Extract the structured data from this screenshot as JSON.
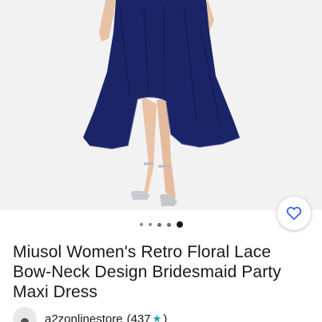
{
  "listing": {
    "title": "Miusol Women's Retro Floral Lace Bow-Neck Design Bridesmaid Party Maxi Dress",
    "image_carousel": {
      "count": 5,
      "active_index": 4
    }
  },
  "seller": {
    "name": "a2zonlinestore",
    "feedback_count_text": "(437",
    "feedback_close": ")",
    "star_icon": "star-icon"
  },
  "actions": {
    "favorite_icon": "heart-outline-icon"
  },
  "colors": {
    "accent_blue": "#3665f3",
    "dress_navy": "#1b2466",
    "star_teal": "#1aa3a3"
  }
}
